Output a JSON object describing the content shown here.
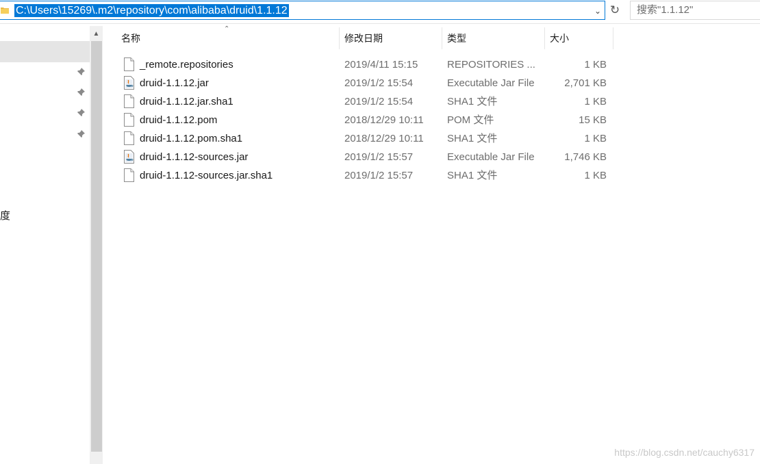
{
  "address_bar": {
    "path": "C:\\Users\\15269\\.m2\\repository\\com\\alibaba\\druid\\1.1.12"
  },
  "search": {
    "placeholder": "搜索\"1.1.12\""
  },
  "nav": {
    "partial_label": "度"
  },
  "columns": {
    "name": "名称",
    "date": "修改日期",
    "type": "类型",
    "size": "大小"
  },
  "files": [
    {
      "name": "_remote.repositories",
      "date": "2019/4/11 15:15",
      "type": "REPOSITORIES ...",
      "size": "1 KB",
      "icon": "file-icon"
    },
    {
      "name": "druid-1.1.12.jar",
      "date": "2019/1/2 15:54",
      "type": "Executable Jar File",
      "size": "2,701 KB",
      "icon": "java-jar-icon"
    },
    {
      "name": "druid-1.1.12.jar.sha1",
      "date": "2019/1/2 15:54",
      "type": "SHA1 文件",
      "size": "1 KB",
      "icon": "file-icon"
    },
    {
      "name": "druid-1.1.12.pom",
      "date": "2018/12/29 10:11",
      "type": "POM 文件",
      "size": "15 KB",
      "icon": "file-icon"
    },
    {
      "name": "druid-1.1.12.pom.sha1",
      "date": "2018/12/29 10:11",
      "type": "SHA1 文件",
      "size": "1 KB",
      "icon": "file-icon"
    },
    {
      "name": "druid-1.1.12-sources.jar",
      "date": "2019/1/2 15:57",
      "type": "Executable Jar File",
      "size": "1,746 KB",
      "icon": "java-jar-icon"
    },
    {
      "name": "druid-1.1.12-sources.jar.sha1",
      "date": "2019/1/2 15:57",
      "type": "SHA1 文件",
      "size": "1 KB",
      "icon": "file-icon"
    }
  ],
  "watermark": "https://blog.csdn.net/cauchy6317",
  "colors": {
    "accent": "#0078d7",
    "selection_bg": "#e5e5e5",
    "secondary_text": "#6d6d6d"
  }
}
